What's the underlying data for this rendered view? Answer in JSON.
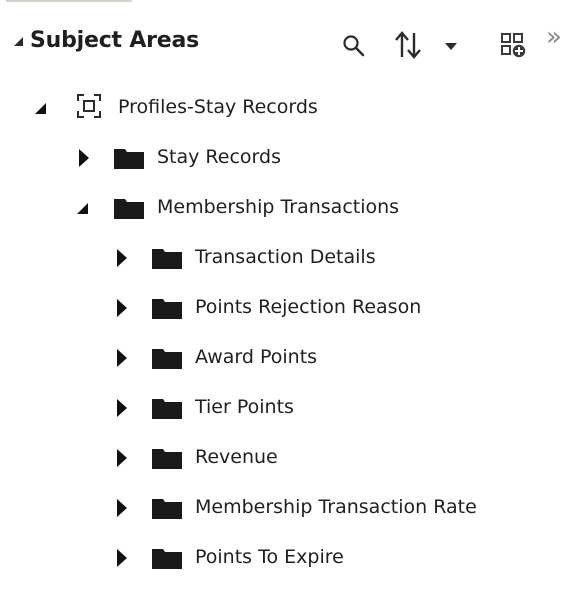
{
  "panel": {
    "title": "Subject Areas",
    "icons": {
      "collapse": "collapse-triangle-icon",
      "search": "search-icon",
      "sort": "sort-icon",
      "sort_menu": "chevron-down-icon",
      "add": "add-subject-area-icon",
      "more": "double-chevron-right-icon"
    }
  },
  "tree": {
    "root": {
      "label": "Profiles-Stay Records",
      "icon": "subject-area-icon",
      "expanded": true
    },
    "items": [
      {
        "label": "Stay Records",
        "icon": "folder-icon",
        "expanded": false
      },
      {
        "label": "Membership Transactions",
        "icon": "folder-icon",
        "expanded": true
      },
      {
        "label": "Transaction Details",
        "icon": "folder-icon",
        "expanded": false
      },
      {
        "label": "Points Rejection Reason",
        "icon": "folder-icon",
        "expanded": false
      },
      {
        "label": "Award Points",
        "icon": "folder-icon",
        "expanded": false
      },
      {
        "label": "Tier Points",
        "icon": "folder-icon",
        "expanded": false
      },
      {
        "label": "Revenue",
        "icon": "folder-icon",
        "expanded": false
      },
      {
        "label": "Membership Transaction Rate",
        "icon": "folder-icon",
        "expanded": false
      },
      {
        "label": "Points To Expire",
        "icon": "folder-icon",
        "expanded": false
      }
    ]
  },
  "colors": {
    "folder": "#1a1a1a",
    "text": "#1f1f1f",
    "muted_icon": "#8a8a8a",
    "accent_line": "#cfd8c8"
  }
}
